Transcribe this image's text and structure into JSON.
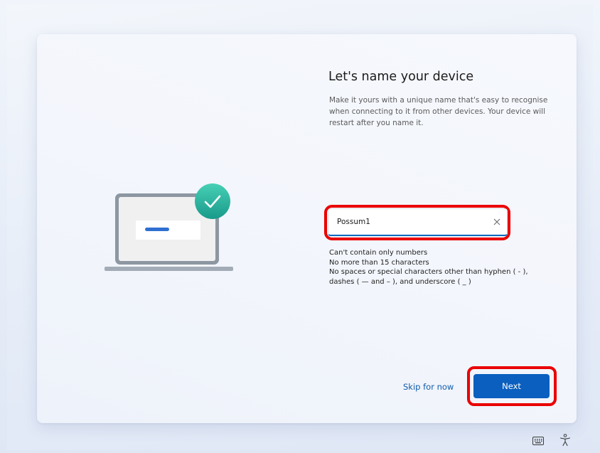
{
  "page": {
    "title": "Let's name your device",
    "description": "Make it yours with a unique name that's easy to recognise when connecting to it from other devices. Your device will restart after you name it."
  },
  "name_field": {
    "value": "Possum1"
  },
  "rules": [
    "Can't contain only numbers",
    "No more than 15 characters",
    "No spaces or special characters other than hyphen ( - ), dashes ( — and – ), and underscore ( _ )"
  ],
  "actions": {
    "skip_label": "Skip for now",
    "next_label": "Next"
  },
  "icons": {
    "illustration": "laptop-with-checkmark-icon",
    "clear": "close-icon",
    "keyboard": "keyboard-icon",
    "accessibility": "accessibility-icon"
  },
  "colors": {
    "accent": "#0a5fbf",
    "link": "#0f5cab",
    "checkmark_badge": "#2bb5a0",
    "highlight": "#ea0000"
  }
}
